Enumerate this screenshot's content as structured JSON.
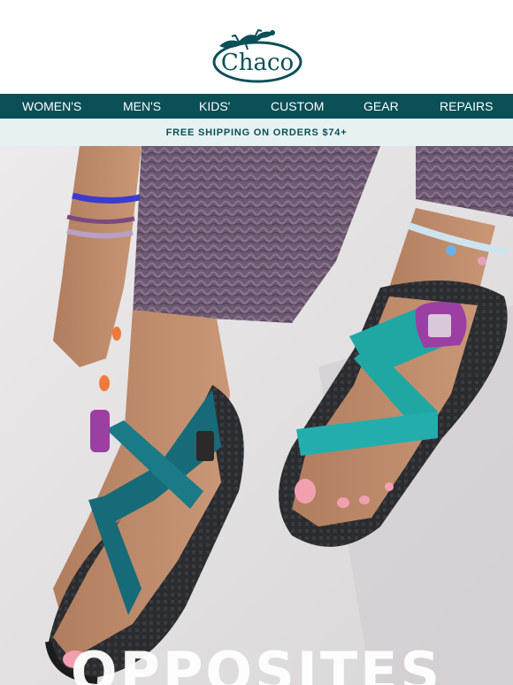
{
  "brand": {
    "name": "Chaco",
    "logo_icon": "lizard-icon"
  },
  "nav": {
    "items": [
      {
        "label": "WOMEN'S"
      },
      {
        "label": "MEN'S"
      },
      {
        "label": "KIDS'"
      },
      {
        "label": "CUSTOM"
      },
      {
        "label": "GEAR"
      },
      {
        "label": "REPAIRS"
      }
    ]
  },
  "promo": {
    "text": "FREE SHIPPING ON ORDERS $74+"
  },
  "hero": {
    "headline": "OPPOSITES",
    "image": "sandal-feet-photo"
  },
  "colors": {
    "nav_bg": "#0b4f57",
    "promo_bg": "#e6f2f1",
    "strap_teal": "#1fa7a4",
    "strap_dark_teal": "#176b78",
    "buckle_purple": "#9b3fa3"
  }
}
